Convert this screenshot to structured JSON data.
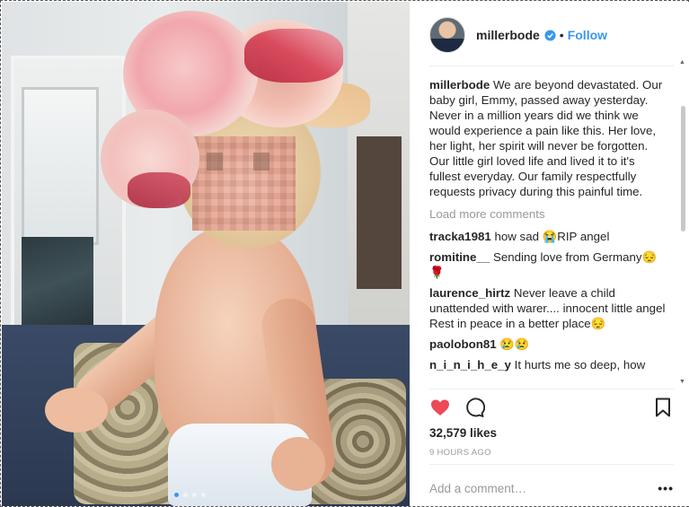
{
  "post": {
    "image_alt_icon": "photo",
    "carousel_dots": 4,
    "carousel_active": 1
  },
  "header": {
    "username": "millerbode",
    "separator": "•",
    "follow_label": "Follow",
    "verified_icon": "verified-badge-icon"
  },
  "caption": {
    "username": "millerbode",
    "text": "We are beyond devastated. Our baby girl, Emmy, passed away yesterday. Never in a million years did we think we would experience a pain like this. Her love, her light, her spirit will never be forgotten. Our little girl loved life and lived it to it's fullest everyday. Our family respectfully requests privacy during this painful time."
  },
  "load_more_label": "Load more comments",
  "comments": [
    {
      "user": "tracka1981",
      "text": "how sad 😭RIP angel"
    },
    {
      "user": "romitine__",
      "text": "Sending love from Germany😔 🌹"
    },
    {
      "user": "laurence_hirtz",
      "text": "Never leave a child unattended with warer.... innocent little angel Rest in peace in a better place😔"
    },
    {
      "user": "paolobon81",
      "text": "😢😢"
    },
    {
      "user": "n_i_n_i_h_e_y",
      "text": "It hurts me so deep, how"
    }
  ],
  "actions": {
    "like_icon": "heart-icon",
    "comment_icon": "comment-icon",
    "save_icon": "bookmark-icon",
    "like_color": "#ed4956"
  },
  "likes_text": "32,579 likes",
  "timestamp": "9 HOURS AGO",
  "add_comment": {
    "placeholder": "Add a comment…",
    "more_label": "•••"
  },
  "colors": {
    "accent": "#3897f0",
    "muted": "#999999",
    "text": "#262626"
  }
}
